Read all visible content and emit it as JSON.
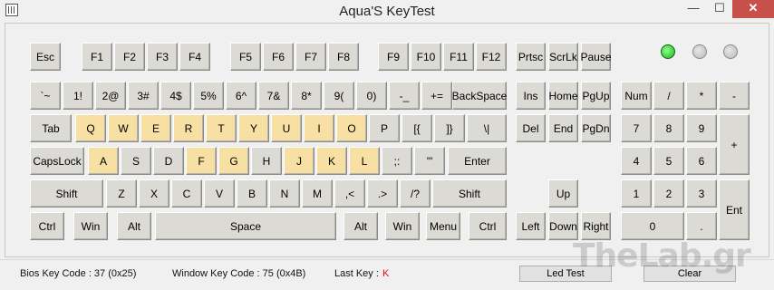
{
  "window": {
    "title": "Aqua'S KeyTest",
    "minimize_glyph": "—",
    "maximize_glyph": "☐",
    "close_glyph": "✕",
    "icon": "keyboard-app-icon"
  },
  "keys": {
    "esc": "Esc",
    "f1": "F1",
    "f2": "F2",
    "f3": "F3",
    "f4": "F4",
    "f5": "F5",
    "f6": "F6",
    "f7": "F7",
    "f8": "F8",
    "f9": "F9",
    "f10": "F10",
    "f11": "F11",
    "f12": "F12",
    "prtsc": "Prtsc",
    "scrlk": "ScrLk",
    "pause": "Pause",
    "backtick": "`~",
    "1": "1!",
    "2": "2@",
    "3": "3#",
    "4": "4$",
    "5": "5%",
    "6": "6^",
    "7": "7&",
    "8": "8*",
    "9": "9(",
    "0": "0)",
    "minus": "-_",
    "equals": "+=",
    "backspace": "BackSpace",
    "ins": "Ins",
    "home": "Home",
    "pgup": "PgUp",
    "numlock": "Num",
    "np_div": "/",
    "np_mul": "*",
    "np_minus": "-",
    "tab": "Tab",
    "q": "Q",
    "w": "W",
    "e": "E",
    "r": "R",
    "t": "T",
    "y": "Y",
    "u": "U",
    "i": "I",
    "o": "O",
    "p": "P",
    "lbracket": "[{",
    "rbracket": "]}",
    "backslash": "\\|",
    "del": "Del",
    "end": "End",
    "pgdn": "PgDn",
    "np7": "7",
    "np8": "8",
    "np9": "9",
    "np_plus": "+",
    "capslock": "CapsLock",
    "a": "A",
    "s": "S",
    "d": "D",
    "f": "F",
    "g": "G",
    "h": "H",
    "j": "J",
    "k": "K",
    "l": "L",
    "semicolon": ";:",
    "quote": "'\"",
    "enter": "Enter",
    "np4": "4",
    "np5": "5",
    "np6": "6",
    "lshift": "Shift",
    "z": "Z",
    "x": "X",
    "c": "C",
    "v": "V",
    "b": "B",
    "n": "N",
    "m": "M",
    "comma": ",<",
    "period": ".>",
    "slash": "/?",
    "rshift": "Shift",
    "up": "Up",
    "np1": "1",
    "np2": "2",
    "np3": "3",
    "np_enter": "Ent",
    "lctrl": "Ctrl",
    "lwin": "Win",
    "lalt": "Alt",
    "space": "Space",
    "ralt": "Alt",
    "rwin": "Win",
    "menu": "Menu",
    "rctrl": "Ctrl",
    "left": "Left",
    "down": "Down",
    "right": "Right",
    "np0": "0",
    "np_dot": "."
  },
  "highlighted": [
    "q",
    "w",
    "e",
    "r",
    "t",
    "y",
    "u",
    "i",
    "o",
    "a",
    "f",
    "g",
    "j",
    "k",
    "l"
  ],
  "leds": [
    {
      "name": "num-lock-led",
      "on": true
    },
    {
      "name": "caps-lock-led",
      "on": false
    },
    {
      "name": "scroll-lock-led",
      "on": false
    }
  ],
  "status": {
    "bios_key_code": "Bios Key Code : 37 (0x25)",
    "window_key_code": "Window Key Code : 75 (0x4B)",
    "last_key_label": "Last Key :",
    "last_key_value": "K",
    "led_test": "Led Test",
    "clear": "Clear"
  },
  "watermark": "TheLab.gr",
  "colors": {
    "highlight": "#f8e0a4",
    "key": "#dcdad5",
    "led_on": "#19b419",
    "last_key": "#dd1111"
  }
}
